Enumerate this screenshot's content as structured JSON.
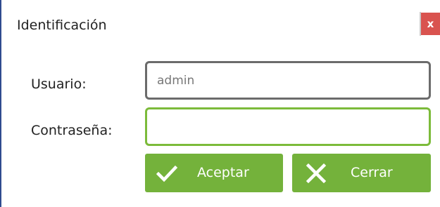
{
  "dialog": {
    "title": "Identificación",
    "close_label": "x"
  },
  "form": {
    "username_label": "Usuario:",
    "username_value": "admin",
    "password_label": "Contraseña:",
    "password_value": ""
  },
  "buttons": {
    "accept_label": "Aceptar",
    "accept_icon": "check-icon",
    "close_label": "Cerrar",
    "close_icon": "x-icon"
  },
  "colors": {
    "accent": "#74b23b",
    "close_button": "#d9534f",
    "focused_border": "#7cbb3a"
  }
}
